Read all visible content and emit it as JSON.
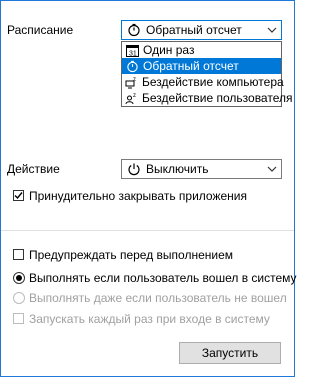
{
  "schedule": {
    "label": "Расписание",
    "selected": "Обратный отсчет",
    "options": [
      {
        "label": "Один раз",
        "icon": "calendar-icon"
      },
      {
        "label": "Обратный отсчет",
        "icon": "stopwatch-icon"
      },
      {
        "label": "Бездействие компьютера",
        "icon": "computer-sleep-icon"
      },
      {
        "label": "Бездействие пользователя",
        "icon": "user-sleep-icon"
      }
    ]
  },
  "action": {
    "label": "Действие",
    "selected": "Выключить",
    "icon": "power-icon"
  },
  "options": {
    "force_close": {
      "label": "Принудительно закрывать приложения",
      "checked": true
    },
    "warn_before": {
      "label": "Предупреждать перед выполнением",
      "checked": false
    },
    "radio_logged_in": {
      "label": "Выполнять если пользователь вошел в систему",
      "checked": true
    },
    "radio_not_logged_in": {
      "label": "Выполнять даже если пользователь не вошел",
      "checked": false,
      "disabled": true
    },
    "run_each_login": {
      "label": "Запускать каждый раз при входе в систему",
      "checked": false,
      "disabled": true
    }
  },
  "run_button": {
    "label": "Запустить"
  },
  "colors": {
    "accent": "#0078d7",
    "border": "#1e78d7",
    "disabled": "#a0a0a0"
  }
}
